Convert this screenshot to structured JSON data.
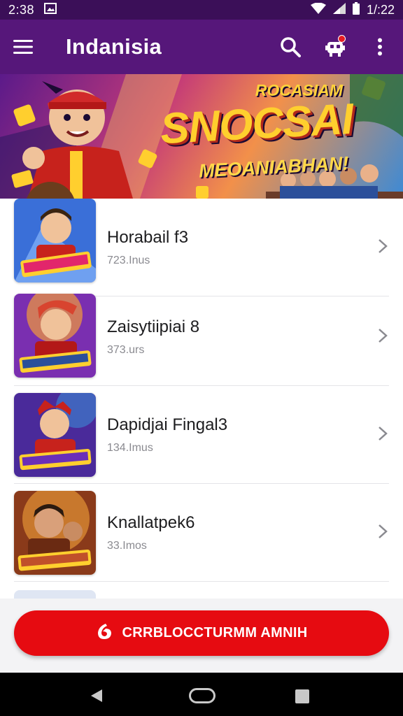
{
  "status_bar": {
    "time_left": "2:38",
    "time_right": "1/:22"
  },
  "app_bar": {
    "title": "Indanisia",
    "menu_icon": "hamburger-menu-icon",
    "search_icon": "search-icon",
    "notification_icon": "robot-notification-icon",
    "more_icon": "more-vert-icon"
  },
  "banner": {
    "top_text": "ROCASIAM",
    "main_text": "SNOCSAI",
    "sub_text": "MEOANIABHAN!"
  },
  "games": [
    {
      "title": "Horabail  f3",
      "meta": "723.Inus",
      "accent": "#3a6fd8"
    },
    {
      "title": "Zaisytiipiai 8",
      "meta": "373.urs",
      "accent": "#d8442f"
    },
    {
      "title": "Dapidjai Fingal3",
      "meta": "134.Imus",
      "accent": "#6a2fb8"
    },
    {
      "title": "Knallatpek6",
      "meta": "33.Imos",
      "accent": "#c0502a"
    }
  ],
  "cta": {
    "label": "CRRBLOCCTURMM AMNIH",
    "icon": "brand-logo-icon",
    "color": "#e60b11"
  },
  "colors": {
    "status_bar": "#3b0f58",
    "app_bar": "#56177a"
  }
}
